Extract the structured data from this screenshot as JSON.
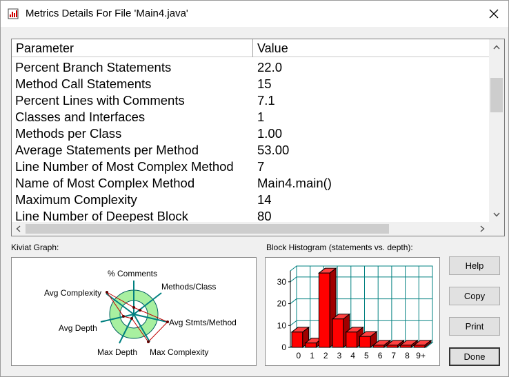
{
  "window": {
    "title": "Metrics Details For File 'Main4.java'"
  },
  "table": {
    "columns": [
      "Parameter",
      "Value"
    ],
    "rows": [
      {
        "param": "Percent Branch Statements",
        "value": "22.0"
      },
      {
        "param": "Method Call Statements",
        "value": "15"
      },
      {
        "param": "Percent Lines with Comments",
        "value": "7.1"
      },
      {
        "param": "Classes and Interfaces",
        "value": "1"
      },
      {
        "param": "Methods per Class",
        "value": "1.00"
      },
      {
        "param": "Average Statements per Method",
        "value": "53.00"
      },
      {
        "param": "Line Number of Most Complex Method",
        "value": "7"
      },
      {
        "param": "Name of Most Complex Method",
        "value": "Main4.main()"
      },
      {
        "param": "Maximum Complexity",
        "value": "14"
      },
      {
        "param": "Line Number of Deepest Block",
        "value": "80"
      }
    ]
  },
  "kiviat": {
    "label": "Kiviat Graph:",
    "axes": [
      "% Comments",
      "Methods/Class",
      "Avg Stmts/Method",
      "Max Complexity",
      "Max Depth",
      "Avg Depth",
      "Avg Complexity"
    ],
    "colors": {
      "ring": "#a8f0a0",
      "spoke": "#008080",
      "polygon": "#c00000"
    }
  },
  "histogram": {
    "label": "Block Histogram (statements vs. depth):",
    "bar_color": "#ff0000"
  },
  "buttons": {
    "help": "Help",
    "copy": "Copy",
    "print": "Print",
    "done": "Done"
  },
  "chart_data": {
    "type": "bar",
    "title": "Block Histogram (statements vs. depth):",
    "categories": [
      "0",
      "1",
      "2",
      "3",
      "4",
      "5",
      "6",
      "7",
      "8",
      "9+"
    ],
    "values": [
      7,
      2,
      34,
      13,
      7,
      5,
      1,
      1,
      1,
      1
    ],
    "ylim": [
      0,
      35
    ],
    "yticks": [
      0,
      10,
      20,
      30
    ],
    "grid": true
  }
}
